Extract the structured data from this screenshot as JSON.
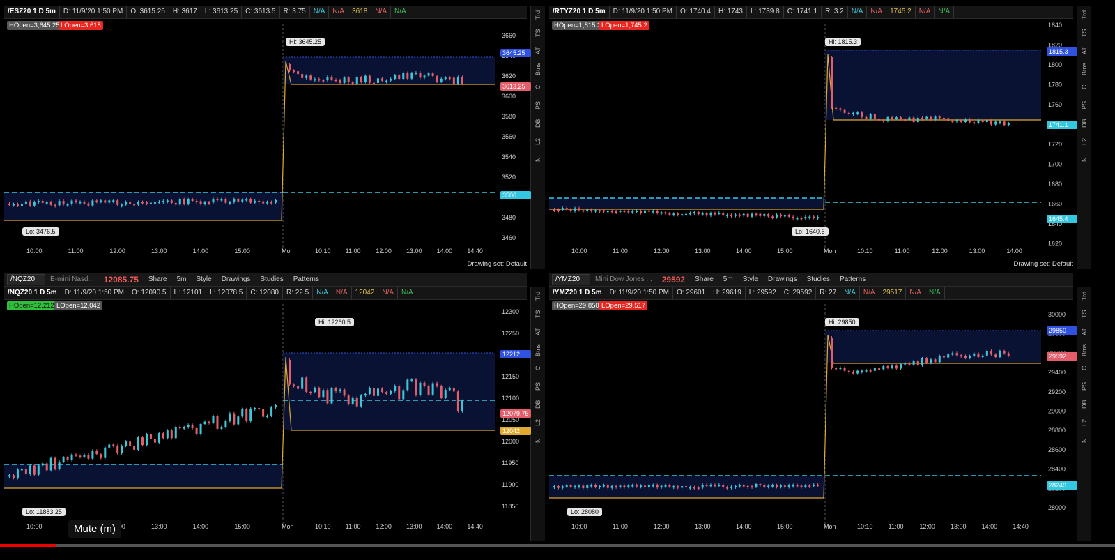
{
  "panels": [
    {
      "id": "es",
      "symbol": "/ESZ20 1 D 5m",
      "date": "D: 11/9/20 1:50 PM",
      "o": "O: 3615.25",
      "h": "H: 3617",
      "l": "L: 3613.25",
      "c": "C: 3613.5",
      "r": "R: 3.75",
      "s1": "N/A",
      "s2": "N/A",
      "s3": "3618",
      "s4": "N/A",
      "s5": "N/A",
      "hopen": "HOpen=3,645.25",
      "lopen": "LOpen=3,618",
      "hi": "Hi: 3645.25",
      "lo": "Lo: 3476.5",
      "yticks": [
        "3660",
        "3640",
        "3620",
        "3600",
        "3580",
        "3560",
        "3540",
        "3520",
        "3500",
        "3480",
        "3460"
      ],
      "xticks": [
        "10:00",
        "11:00",
        "12:00",
        "13:00",
        "14:00",
        "15:00",
        "Mon",
        "10:10",
        "11:00",
        "12:00",
        "13:00",
        "14:00",
        "14:40"
      ],
      "tags": [
        "3645.25",
        "3613.25",
        "3506"
      ],
      "drawing": "Drawing set: Default"
    },
    {
      "id": "rty",
      "symbol": "/RTYZ20 1 D 5m",
      "date": "D: 11/9/20 1:50 PM",
      "o": "O: 1740.4",
      "h": "H: 1743",
      "l": "L: 1739.8",
      "c": "C: 1741.1",
      "r": "R: 3.2",
      "s1": "N/A",
      "s2": "N/A",
      "s3": "1745.2",
      "s4": "N/A",
      "s5": "N/A",
      "hopen": "HOpen=1,815.3",
      "lopen": "LOpen=1,745.2",
      "hi": "Hi: 1815.3",
      "lo": "Lo: 1640.6",
      "yticks": [
        "1840",
        "1820",
        "1800",
        "1780",
        "1760",
        "1740",
        "1720",
        "1700",
        "1680",
        "1660",
        "1640",
        "1620"
      ],
      "xticks": [
        "10:00",
        "11:00",
        "12:00",
        "13:00",
        "14:00",
        "15:00",
        "Mon",
        "10:10",
        "11:00",
        "12:00",
        "13:00",
        "14:00"
      ],
      "tags": [
        "1815.3",
        "1741.1",
        "1645.4"
      ],
      "drawing": "Drawing set: Default"
    },
    {
      "id": "nq",
      "tsym": "/NQZ20",
      "tdesc": "E-mini Nasd...",
      "tprice": "12085.75",
      "symbol": "/NQZ20 1 D 5m",
      "date": "D: 11/9/20 1:50 PM",
      "o": "O: 12090.5",
      "h": "H: 12101",
      "l": "L: 12078.5",
      "c": "C: 12080",
      "r": "R: 22.5",
      "s1": "N/A",
      "s2": "N/A",
      "s3": "12042",
      "s4": "N/A",
      "s5": "N/A",
      "hopen": "HOpen=12,212",
      "lopen": "LOpen=12,042",
      "hi": "Hi: 12260.5",
      "lo": "Lo: 11883.25",
      "yticks": [
        "12300",
        "12250",
        "12200",
        "12150",
        "12100",
        "12050",
        "12000",
        "11950",
        "11900",
        "11850"
      ],
      "xticks": [
        "10:00",
        "11:00",
        "12:00",
        "13:00",
        "14:00",
        "15:00",
        "Mon",
        "10:10",
        "11:00",
        "12:00",
        "13:00",
        "14:00",
        "14:40"
      ],
      "tags": [
        "12212",
        "12079.75",
        "12042"
      ]
    },
    {
      "id": "ym",
      "tsym": "/YMZ20",
      "tdesc": "Mini Dow Jones ...",
      "tprice": "29592",
      "symbol": "/YMZ20 1 D 5m",
      "date": "D: 11/9/20 1:50 PM",
      "o": "O: 29601",
      "h": "H: 29619",
      "l": "L: 29592",
      "c": "C: 29592",
      "r": "R: 27",
      "s1": "N/A",
      "s2": "N/A",
      "s3": "29517",
      "s4": "N/A",
      "s5": "N/A",
      "hopen": "HOpen=29,850",
      "lopen": "LOpen=29,517",
      "hi": "Hi: 29850",
      "lo": "Lo: 28080",
      "yticks": [
        "30000",
        "29800",
        "29600",
        "29400",
        "29200",
        "29000",
        "28800",
        "28600",
        "28400",
        "28200",
        "28000"
      ],
      "xticks": [
        "10:00",
        "11:00",
        "12:00",
        "13:00",
        "14:00",
        "15:00",
        "Mon",
        "10:10",
        "11:00",
        "12:00",
        "13:00",
        "14:00",
        "14:40"
      ],
      "tags": [
        "29850",
        "29592",
        "28240"
      ]
    }
  ],
  "toolbar": {
    "share": "Share",
    "style": "Style",
    "drawings": "Drawings",
    "studies": "Studies",
    "patterns": "Patterns",
    "interval": "5m"
  },
  "side": [
    "Trd",
    "TS",
    "AT",
    "Btns",
    "C",
    "PS",
    "DB",
    "L2",
    "N"
  ],
  "mute": "Mute (m)",
  "colors": {
    "up": "#3fc6d6",
    "down": "#e35d6a",
    "hopen": "#2f52e0",
    "lopen": "#e8261f",
    "gold": "#e0a92f",
    "cyan": "#36c7e0"
  }
}
